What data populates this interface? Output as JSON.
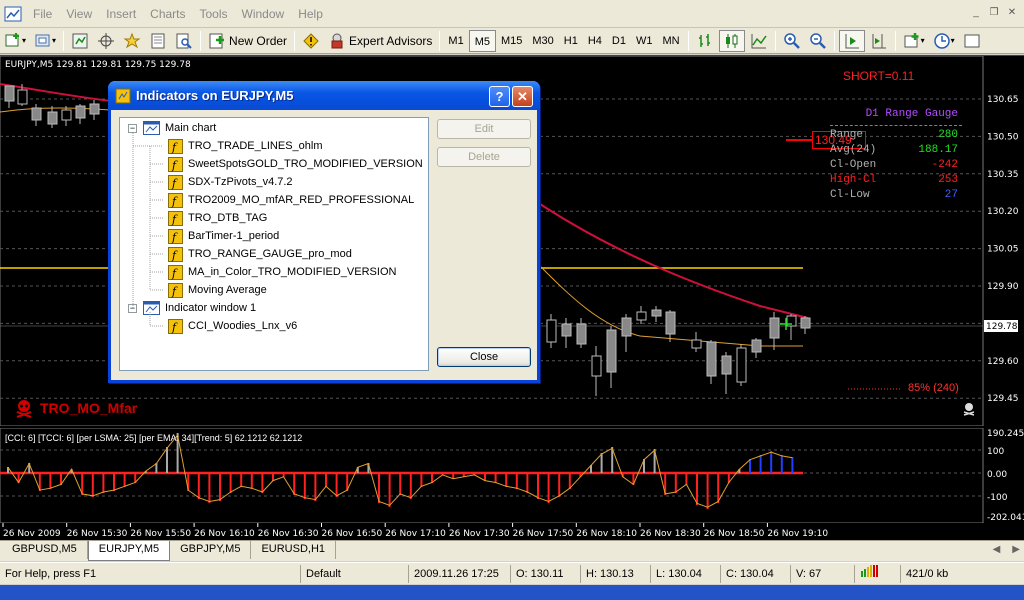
{
  "menu": [
    "File",
    "View",
    "Insert",
    "Charts",
    "Tools",
    "Window",
    "Help"
  ],
  "toolbar": {
    "new_order": "New Order",
    "expert_advisors": "Expert Advisors",
    "timeframes": [
      "M1",
      "M5",
      "M15",
      "M30",
      "H1",
      "H4",
      "D1",
      "W1",
      "MN"
    ],
    "active_timeframe": "M5"
  },
  "chart": {
    "title": "EURJPY,M5  129.81 129.81 129.75 129.78",
    "short_label": "SHORT=0.11",
    "price_tag": "130.49",
    "current_price": "129.78",
    "price_axis": [
      "130.65",
      "130.50",
      "130.35",
      "130.20",
      "130.05",
      "129.90",
      "129.75",
      "129.60",
      "129.45"
    ],
    "gauge": {
      "title": "D1 Range Gauge",
      "rows": [
        {
          "label": "Range",
          "value": "280",
          "label_color": "#b0b0b0",
          "value_color": "#20e020"
        },
        {
          "label": "Avg(24)",
          "value": "188.17",
          "label_color": "#b0b0b0",
          "value_color": "#20e020"
        },
        {
          "label": "Cl-Open",
          "value": "-242",
          "label_color": "#b0b0b0",
          "value_color": "#ff2020"
        },
        {
          "label": "High-Cl",
          "value": "253",
          "label_color": "#ff2020",
          "value_color": "#ff2020"
        },
        {
          "label": "Cl-Low",
          "value": "27",
          "label_color": "#b0b0b0",
          "value_color": "#4060ff"
        }
      ]
    },
    "tro_label": "TRO_MO_Mfar",
    "pct_label": "85% (240)",
    "cci_label": "[CCI: 6] [TCCI: 6] [per LSMA: 25] [per EMA: 34][Trend: 5] 62.1212 62.1212",
    "cci_axis": [
      "190.245",
      "100",
      "0.00",
      "-100",
      "-202.041"
    ],
    "time_axis": [
      "26 Nov 2009",
      "26 Nov 15:30",
      "26 Nov 15:50",
      "26 Nov 16:10",
      "26 Nov 16:30",
      "26 Nov 16:50",
      "26 Nov 17:10",
      "26 Nov 17:30",
      "26 Nov 17:50",
      "26 Nov 18:10",
      "26 Nov 18:30",
      "26 Nov 18:50",
      "26 Nov 19:10"
    ]
  },
  "dialog": {
    "title": "Indicators on EURJPY,M5",
    "tree": {
      "main_chart": "Main chart",
      "main_items": [
        "TRO_TRADE_LINES_ohlm",
        "SweetSpotsGOLD_TRO_MODIFIED_VERSION",
        "SDX-TzPivots_v4.7.2",
        "TRO2009_MO_mfAR_RED_PROFESSIONAL",
        "TRO_DTB_TAG",
        "BarTimer-1_period",
        "TRO_RANGE_GAUGE_pro_mod",
        "MA_in_Color_TRO_MODIFIED_VERSION",
        "Moving Average"
      ],
      "indicator_window": "Indicator window 1",
      "window_items": [
        "CCI_Woodies_Lnx_v6"
      ]
    },
    "edit_label": "Edit",
    "delete_label": "Delete",
    "close_label": "Close"
  },
  "tabs": [
    "GBPUSD,M5",
    "EURJPY,M5",
    "GBPJPY,M5",
    "EURUSD,H1"
  ],
  "active_tab": "EURJPY,M5",
  "status": {
    "help": "For Help, press F1",
    "profile": "Default",
    "datetime": "2009.11.26 17:25",
    "open": "O: 130.11",
    "high": "H: 130.13",
    "low": "L: 130.04",
    "close": "C: 130.04",
    "volume": "V: 67",
    "traffic": "421/0 kb"
  }
}
